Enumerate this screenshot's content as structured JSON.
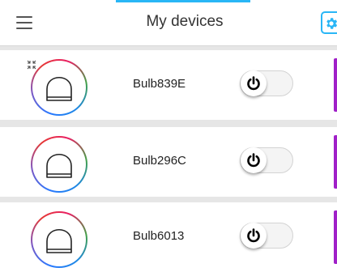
{
  "header": {
    "title": "My devices",
    "accent_color": "#29b6f6"
  },
  "devices": [
    {
      "name": "Bulb839E",
      "power_icon": "power-icon",
      "state": "off"
    },
    {
      "name": "Bulb296C",
      "power_icon": "power-icon",
      "state": "off"
    },
    {
      "name": "Bulb6013",
      "power_icon": "power-icon",
      "state": "off"
    }
  ],
  "colors": {
    "background": "#e6e6e6",
    "card": "#ffffff",
    "strip": "#a020c8"
  }
}
